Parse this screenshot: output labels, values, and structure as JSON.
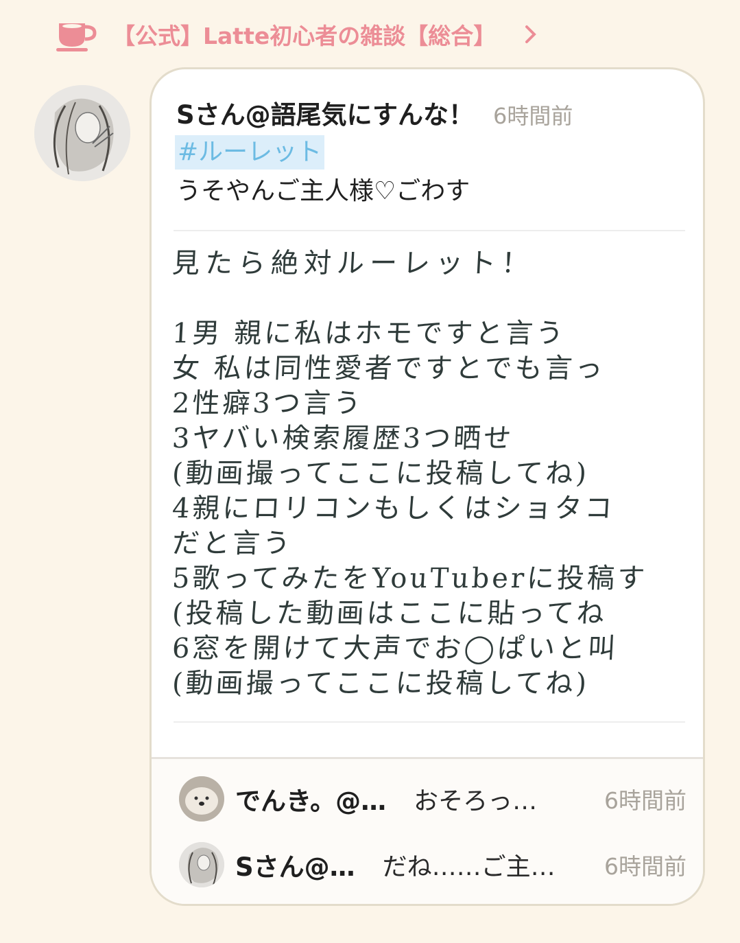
{
  "header": {
    "cup_icon": "tea-cup-icon",
    "title": "【公式】Latte初心者の雑談【総合】",
    "chevron_icon": "chevron-right-icon",
    "accent_color": "#ec8d96"
  },
  "post": {
    "author": "Sさん@語尾気にすんな！",
    "time": "6時間前",
    "hashtag": "#ルーレット",
    "body": "うそやんご主人様♡ごわす",
    "image_text": {
      "title": "見たら絶対ルーレット！",
      "lines": [
        "1男 親に私はホモですと言う",
        "女 私は同性愛者ですとでも言っ",
        "2性癖3つ言う",
        "3ヤバい検索履歴3つ晒せ",
        "(動画撮ってここに投稿してね)",
        "4親にロリコンもしくはショタコ",
        "だと言う",
        "5歌ってみたをYouTuberに投稿す",
        "(投稿した動画はここに貼ってね",
        "6窓を開けて大声でお◯ぱいと叫",
        "(動画撮ってここに投稿してね)"
      ]
    }
  },
  "comments": [
    {
      "name": "でんき。@…",
      "text": "おそろっ…",
      "time": "6時間前"
    },
    {
      "name": "Sさん@…",
      "text": "だね……ご主…",
      "time": "6時間前"
    }
  ]
}
